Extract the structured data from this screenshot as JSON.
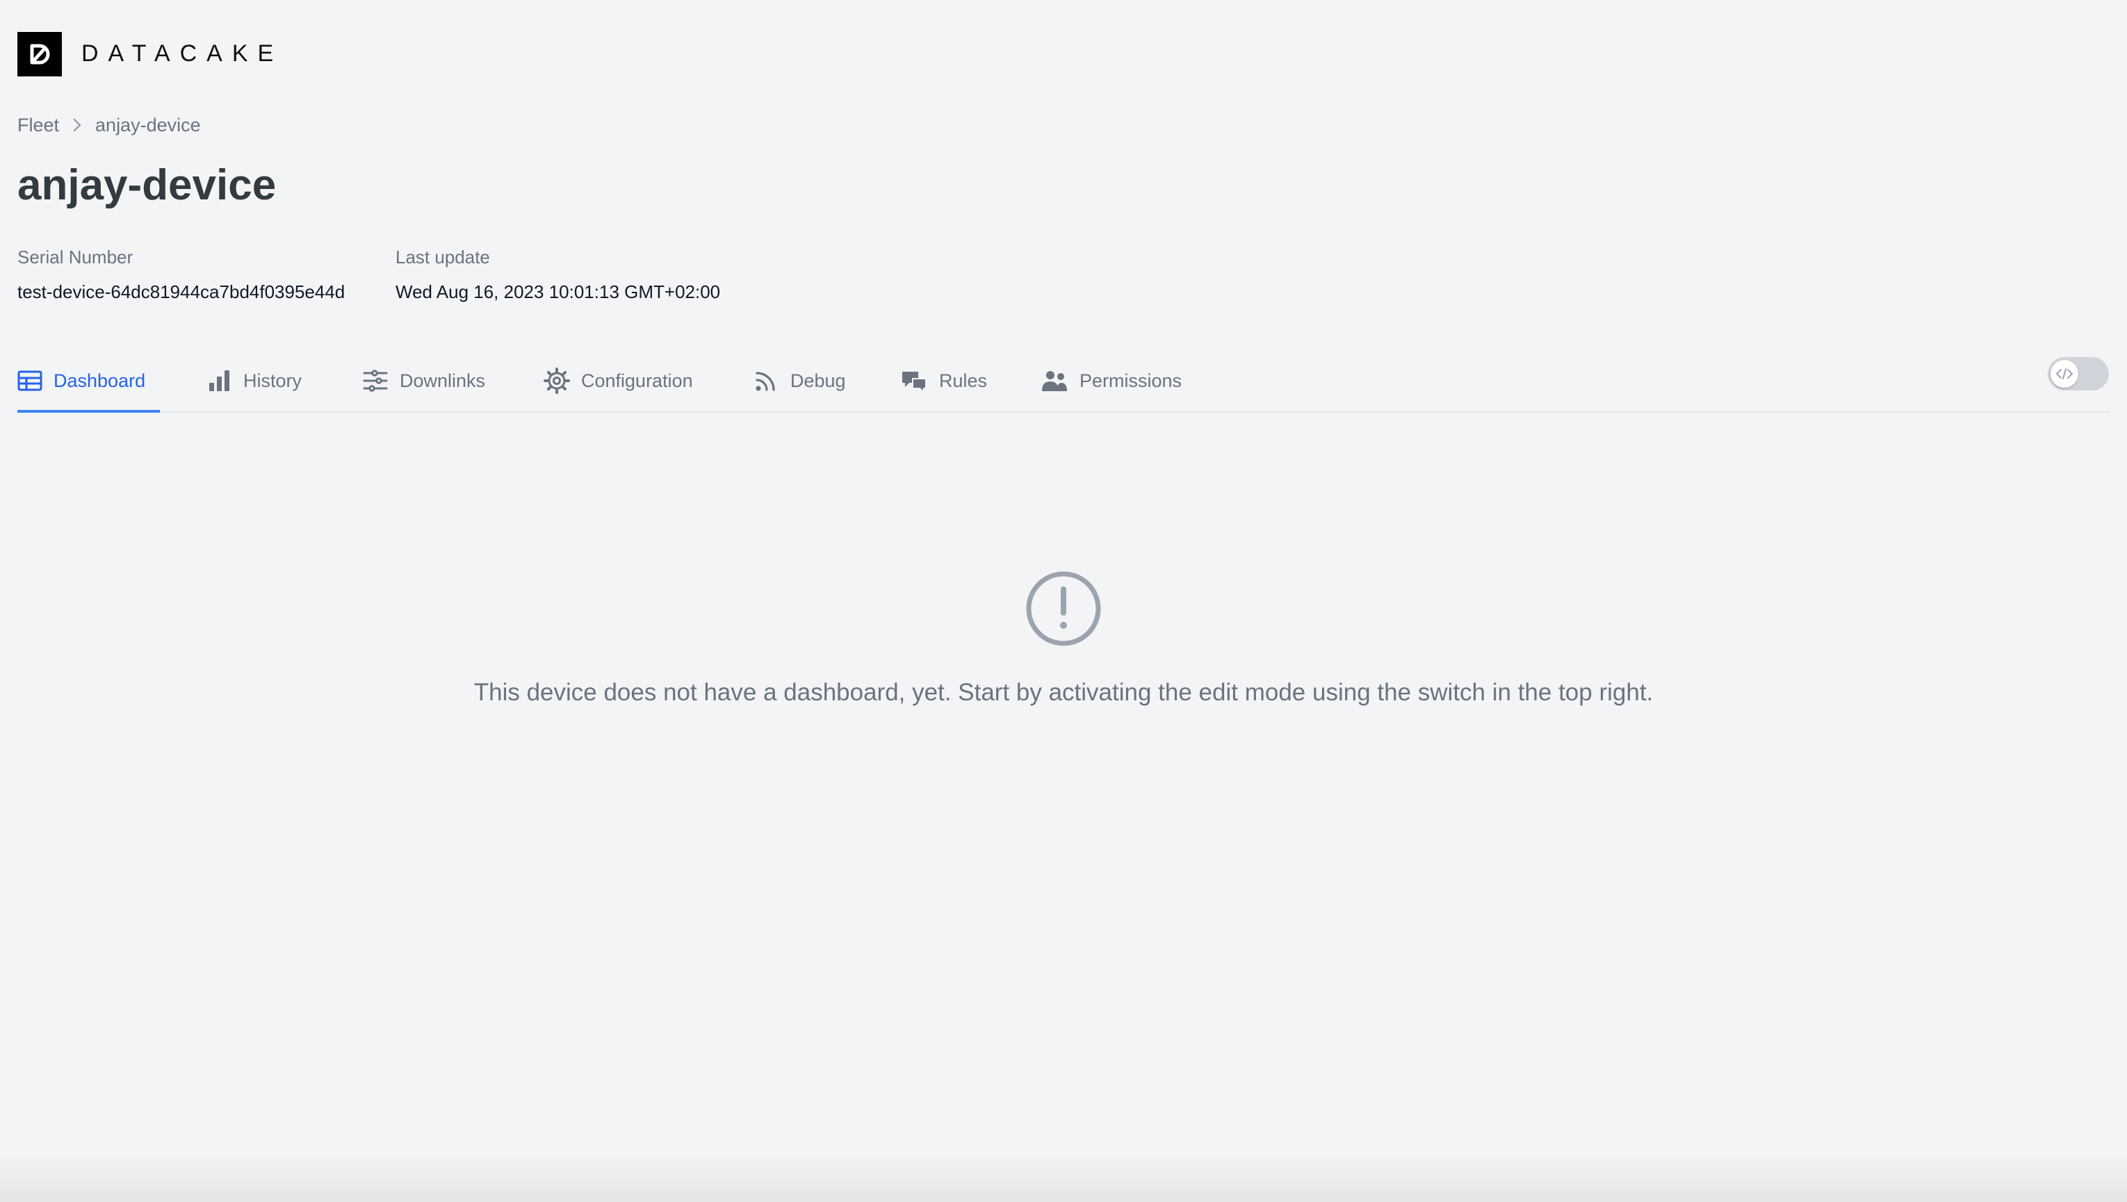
{
  "brand": {
    "name": "DATACAKE",
    "logo_icon": "datacake-logo-icon"
  },
  "breadcrumb": {
    "items": [
      "Fleet",
      "anjay-device"
    ],
    "separator_icon": "chevron-right-icon"
  },
  "device": {
    "title": "anjay-device",
    "serial_label": "Serial Number",
    "serial_value": "test-device-64dc81944ca7bd4f0395e44d",
    "update_label": "Last update",
    "update_value": "Wed Aug 16, 2023 10:01:13 GMT+02:00"
  },
  "tabs": [
    {
      "label": "Dashboard",
      "icon": "dashboard-table-icon",
      "active": true
    },
    {
      "label": "History",
      "icon": "bar-chart-icon",
      "active": false
    },
    {
      "label": "Downlinks",
      "icon": "sliders-icon",
      "active": false
    },
    {
      "label": "Configuration",
      "icon": "gear-icon",
      "active": false
    },
    {
      "label": "Debug",
      "icon": "rss-icon",
      "active": false
    },
    {
      "label": "Rules",
      "icon": "chat-bubbles-icon",
      "active": false
    },
    {
      "label": "Permissions",
      "icon": "users-icon",
      "active": false
    }
  ],
  "edit_mode_toggle": {
    "state": "off",
    "icon": "code-icon"
  },
  "empty_state": {
    "icon": "exclamation-circle-icon",
    "message": "This device does not have a dashboard, yet. Start by activating the edit mode using the switch in the top right."
  },
  "colors": {
    "accent": "#2563eb",
    "text_muted": "#6b7280",
    "background": "#f3f4f6"
  }
}
